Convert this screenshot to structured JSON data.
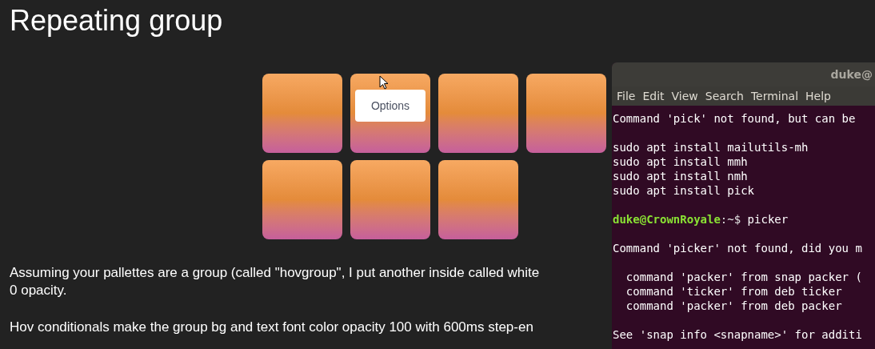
{
  "heading": "Repeating group",
  "tiles": [
    {
      "kind": "plain"
    },
    {
      "kind": "hovered",
      "tooltip": "Options"
    },
    {
      "kind": "plain"
    },
    {
      "kind": "plain"
    },
    {
      "kind": "plain"
    },
    {
      "kind": "plain"
    },
    {
      "kind": "plain"
    }
  ],
  "paragraphs": [
    [
      "Assuming your pallettes are a group (called \"hovgroup\", I put another inside called white",
      "0 opacity."
    ],
    [
      "Hov conditionals make the group bg and text font color opacity 100 with 600ms step-en"
    ]
  ],
  "terminal": {
    "title": "duke@",
    "menu": [
      "File",
      "Edit",
      "View",
      "Search",
      "Terminal",
      "Help"
    ],
    "lines": [
      {
        "kind": "output",
        "text": "Command 'pick' not found, but can be"
      },
      {
        "kind": "blank"
      },
      {
        "kind": "output",
        "text": "sudo apt install mailutils-mh"
      },
      {
        "kind": "output",
        "text": "sudo apt install mmh"
      },
      {
        "kind": "output",
        "text": "sudo apt install nmh"
      },
      {
        "kind": "output",
        "text": "sudo apt install pick"
      },
      {
        "kind": "blank"
      },
      {
        "kind": "prompt",
        "user_host": "duke@CrownRoyale",
        "path": ":~$",
        "command": "picker"
      },
      {
        "kind": "blank"
      },
      {
        "kind": "output",
        "text": "Command 'picker' not found, did you m"
      },
      {
        "kind": "blank"
      },
      {
        "kind": "output",
        "text": "  command 'packer' from snap packer ("
      },
      {
        "kind": "output",
        "text": "  command 'ticker' from deb ticker"
      },
      {
        "kind": "output",
        "text": "  command 'packer' from deb packer"
      },
      {
        "kind": "blank"
      },
      {
        "kind": "output",
        "text": "See 'snap info <snapname>' for additi"
      }
    ]
  }
}
